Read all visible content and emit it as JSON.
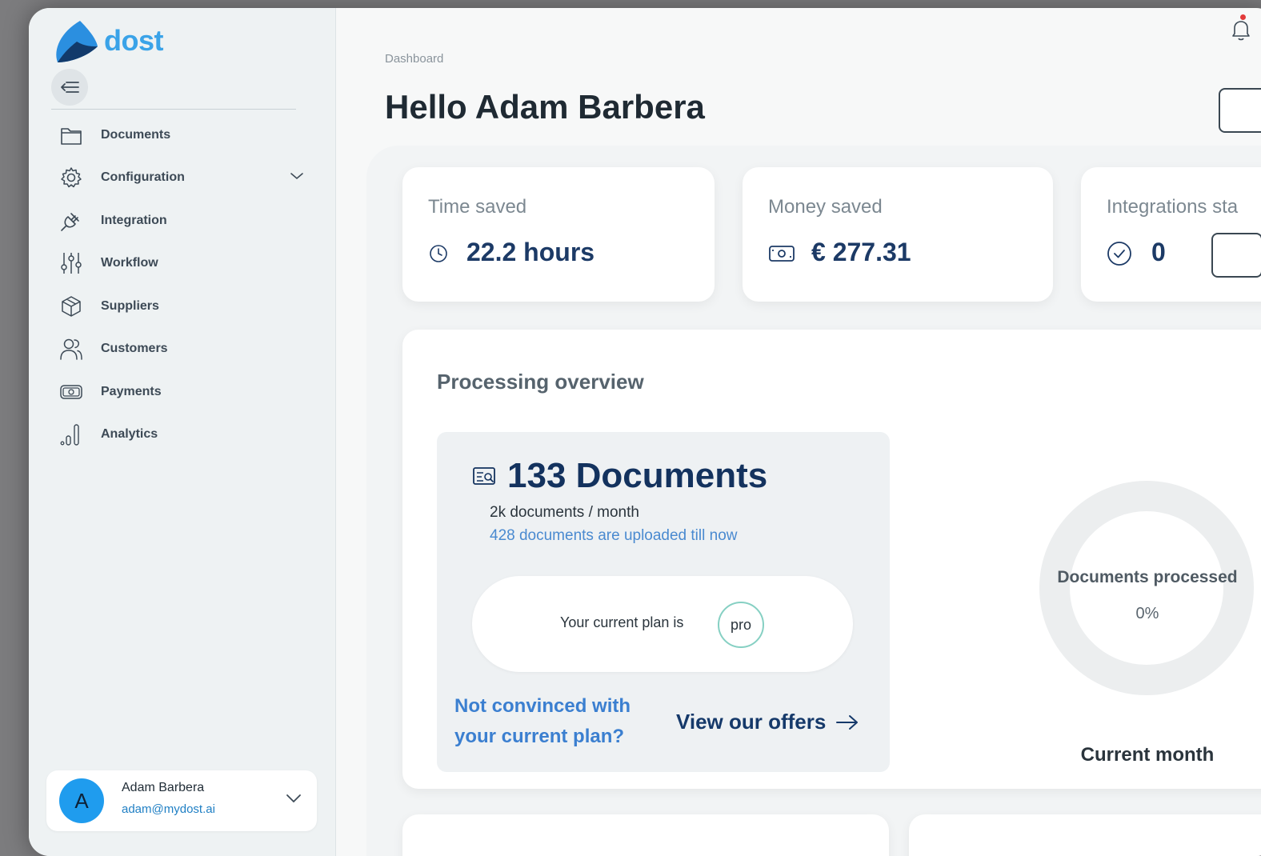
{
  "brand": {
    "name": "dost",
    "color": "#3aa3e8"
  },
  "sidebar": {
    "items": [
      {
        "label": "Documents",
        "icon": "folder-icon"
      },
      {
        "label": "Configuration",
        "icon": "gear-icon",
        "has_submenu": true
      },
      {
        "label": "Integration",
        "icon": "plug-icon"
      },
      {
        "label": "Workflow",
        "icon": "sliders-icon"
      },
      {
        "label": "Suppliers",
        "icon": "box-icon"
      },
      {
        "label": "Customers",
        "icon": "users-icon"
      },
      {
        "label": "Payments",
        "icon": "banknote-icon"
      },
      {
        "label": "Analytics",
        "icon": "bar-chart-icon"
      }
    ],
    "user": {
      "initial": "A",
      "name": "Adam Barbera",
      "email": "adam@mydost.ai"
    }
  },
  "header": {
    "breadcrumb": "Dashboard",
    "title": "Hello Adam Barbera"
  },
  "stats": {
    "time_saved": {
      "label": "Time saved",
      "value": "22.2 hours",
      "icon": "clock-icon"
    },
    "money_saved": {
      "label": "Money saved",
      "value": "€ 277.31",
      "icon": "banknote-icon"
    },
    "integrations": {
      "label": "Integrations sta",
      "value": "0",
      "icon": "check-circle-icon"
    }
  },
  "overview": {
    "title": "Processing overview",
    "documents_count": "133 Documents",
    "documents_rate": "2k documents / month",
    "documents_uploaded": "428 documents are uploaded till now",
    "plan_text": "Your current plan is",
    "plan_name": "pro",
    "not_convinced": "Not convinced with your current plan?",
    "offers_link": "View our offers",
    "donut": {
      "title": "Documents processed",
      "value": "0%",
      "fraction": 0,
      "period": "Current month"
    }
  }
}
